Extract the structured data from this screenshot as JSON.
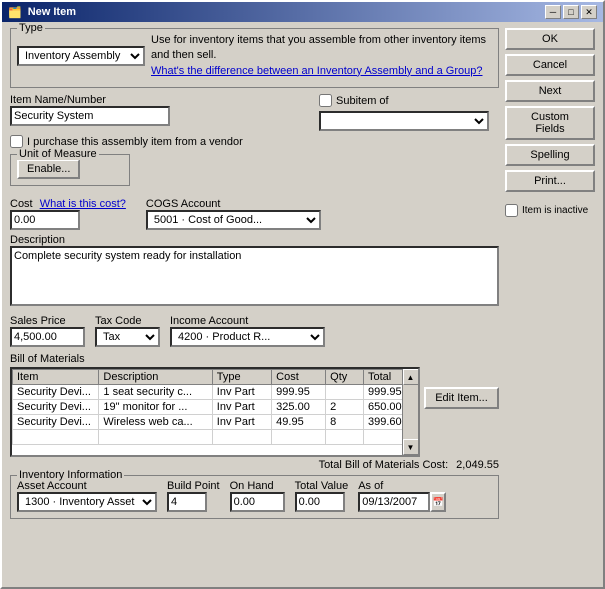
{
  "window": {
    "title": "New Item",
    "title_icon": "📦"
  },
  "type_section": {
    "label": "Type",
    "selected_type": "Inventory Assembly",
    "description": "Use for inventory items that you assemble from other inventory items and then sell.",
    "link_text": "What's the difference between an Inventory Assembly and a Group?"
  },
  "item_name": {
    "label": "Item Name/Number",
    "value": "Security System",
    "subitem_label": "Subitem of",
    "subitem_checked": false,
    "subitem_value": ""
  },
  "vendor_checkbox": {
    "label": "I purchase this assembly item from a vendor",
    "checked": false
  },
  "uom": {
    "label": "Unit of Measure",
    "enable_button": "Enable..."
  },
  "cost": {
    "label": "Cost",
    "what_link": "What is this cost?",
    "value": "0.00"
  },
  "cogs": {
    "label": "COGS Account",
    "value": "5001 · Cost of Good..."
  },
  "description": {
    "label": "Description",
    "value": "Complete security system ready for installation"
  },
  "sales_price": {
    "label": "Sales Price",
    "value": "4,500.00"
  },
  "tax_code": {
    "label": "Tax Code",
    "value": "Tax"
  },
  "income_account": {
    "label": "Income Account",
    "value": "4200 · Product R..."
  },
  "bom": {
    "label": "Bill of Materials",
    "columns": [
      "Item",
      "Description",
      "Type",
      "Cost",
      "Qty",
      "Total"
    ],
    "rows": [
      {
        "item": "Security Devi...",
        "description": "1 seat security c...",
        "type": "Inv Part",
        "cost": "999.95",
        "qty": "",
        "total": "999.95"
      },
      {
        "item": "Security Devi...",
        "description": "19\" monitor for ...",
        "type": "Inv Part",
        "cost": "325.00",
        "qty": "2",
        "total": "650.00"
      },
      {
        "item": "Security Devi...",
        "description": "Wireless web ca...",
        "type": "Inv Part",
        "cost": "49.95",
        "qty": "8",
        "total": "399.60"
      }
    ],
    "total_label": "Total Bill of Materials Cost:",
    "total_value": "2,049.55"
  },
  "inventory": {
    "label": "Inventory Information",
    "asset_account_label": "Asset Account",
    "asset_account_value": "1300 · Inventory Asset",
    "build_point_label": "Build Point",
    "build_point_value": "4",
    "on_hand_label": "On Hand",
    "on_hand_value": "0.00",
    "total_value_label": "Total Value",
    "total_value_value": "0.00",
    "as_of_label": "As of",
    "as_of_value": "09/13/2007"
  },
  "buttons": {
    "ok": "OK",
    "cancel": "Cancel",
    "next": "Next",
    "custom_fields": "Custom Fields",
    "spelling": "Spelling",
    "print": "Print...",
    "item_inactive": "Item is inactive",
    "edit_item": "Edit Item..."
  },
  "title_buttons": {
    "minimize": "─",
    "maximize": "□",
    "close": "✕"
  }
}
